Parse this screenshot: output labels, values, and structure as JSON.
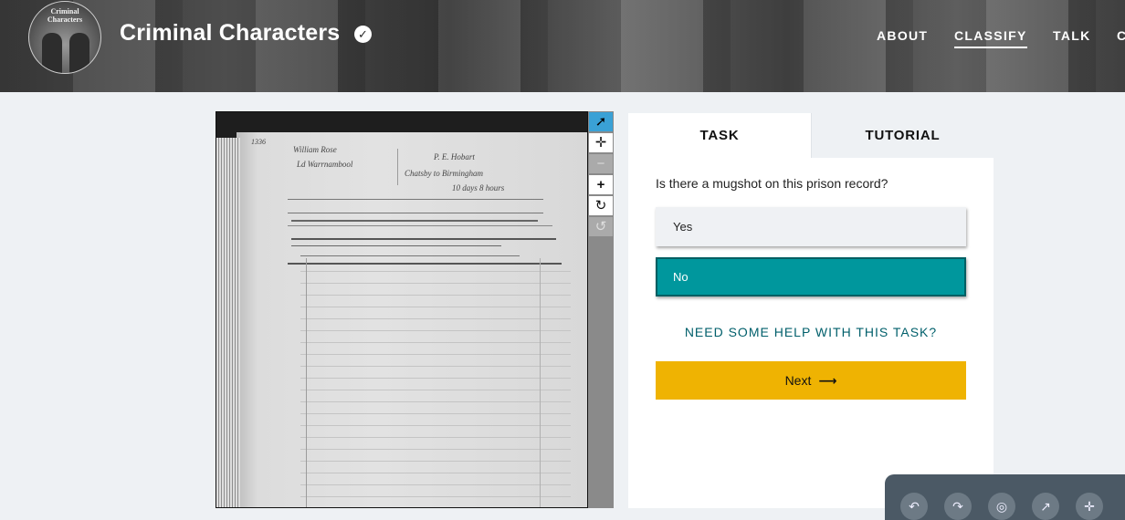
{
  "header": {
    "avatar_text": "Criminal\nCharacters",
    "title": "Criminal Characters",
    "verified_icon": "check-circle-icon",
    "nav": [
      {
        "label": "ABOUT",
        "active": false
      },
      {
        "label": "CLASSIFY",
        "active": true
      },
      {
        "label": "TALK",
        "active": false
      },
      {
        "label": "C",
        "active": false
      }
    ]
  },
  "viewer": {
    "page_number": "1336",
    "document_text": [
      "William Rose",
      "Ld Warrnambool",
      "P. E. Hobart",
      "Chatsby to Birmingham",
      "10 days 8 hours"
    ]
  },
  "toolbar": {
    "tools": [
      {
        "icon": "pointer-icon",
        "glyph": "➚",
        "state": "active"
      },
      {
        "icon": "move-icon",
        "glyph": "✛",
        "state": "normal"
      },
      {
        "icon": "zoom-out-icon",
        "glyph": "−",
        "state": "disabled"
      },
      {
        "icon": "zoom-in-icon",
        "glyph": "+",
        "state": "normal"
      },
      {
        "icon": "rotate-icon",
        "glyph": "↻",
        "state": "normal"
      },
      {
        "icon": "reset-icon",
        "glyph": "↺",
        "state": "disabled"
      }
    ]
  },
  "task": {
    "tabs": {
      "task": "TASK",
      "tutorial": "TUTORIAL"
    },
    "question": "Is there a mugshot on this prison record?",
    "answers": [
      {
        "label": "Yes",
        "selected": false
      },
      {
        "label": "No",
        "selected": true
      }
    ],
    "help_link": "NEED SOME HELP WITH THIS TASK?",
    "next_label": "Next",
    "next_arrow": "⟶"
  },
  "dock": {
    "buttons": [
      "↶",
      "↷",
      "◎",
      "↗",
      "✛"
    ]
  },
  "colors": {
    "accent_teal": "#00979d",
    "next_yellow": "#efb302",
    "link_teal": "#005f6b",
    "tool_active": "#3aa1d6"
  }
}
